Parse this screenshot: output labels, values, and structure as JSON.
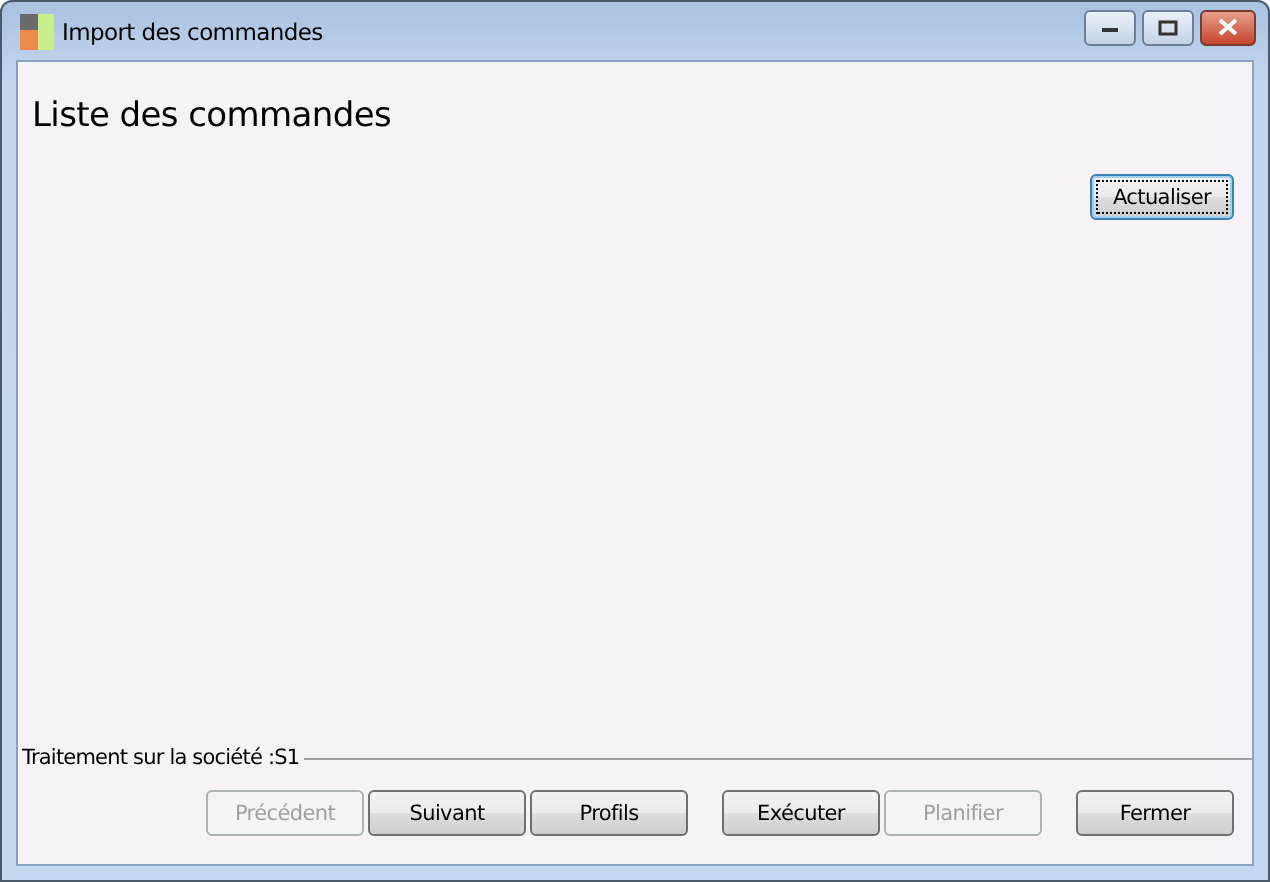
{
  "window": {
    "title": "Import des commandes"
  },
  "heading": "Liste des commandes",
  "refresh_button": {
    "label": "Actualiser",
    "focused": true
  },
  "company_group": {
    "label": "Traitement sur la société :S1"
  },
  "button_groups": [
    [
      {
        "label": "Précédent",
        "disabled": true
      },
      {
        "label": "Suivant",
        "disabled": false
      },
      {
        "label": "Profils",
        "disabled": false
      }
    ],
    [
      {
        "label": "Exécuter",
        "disabled": false
      },
      {
        "label": "Planifier",
        "disabled": true
      }
    ],
    [
      {
        "label": "Fermer",
        "disabled": false
      }
    ]
  ]
}
